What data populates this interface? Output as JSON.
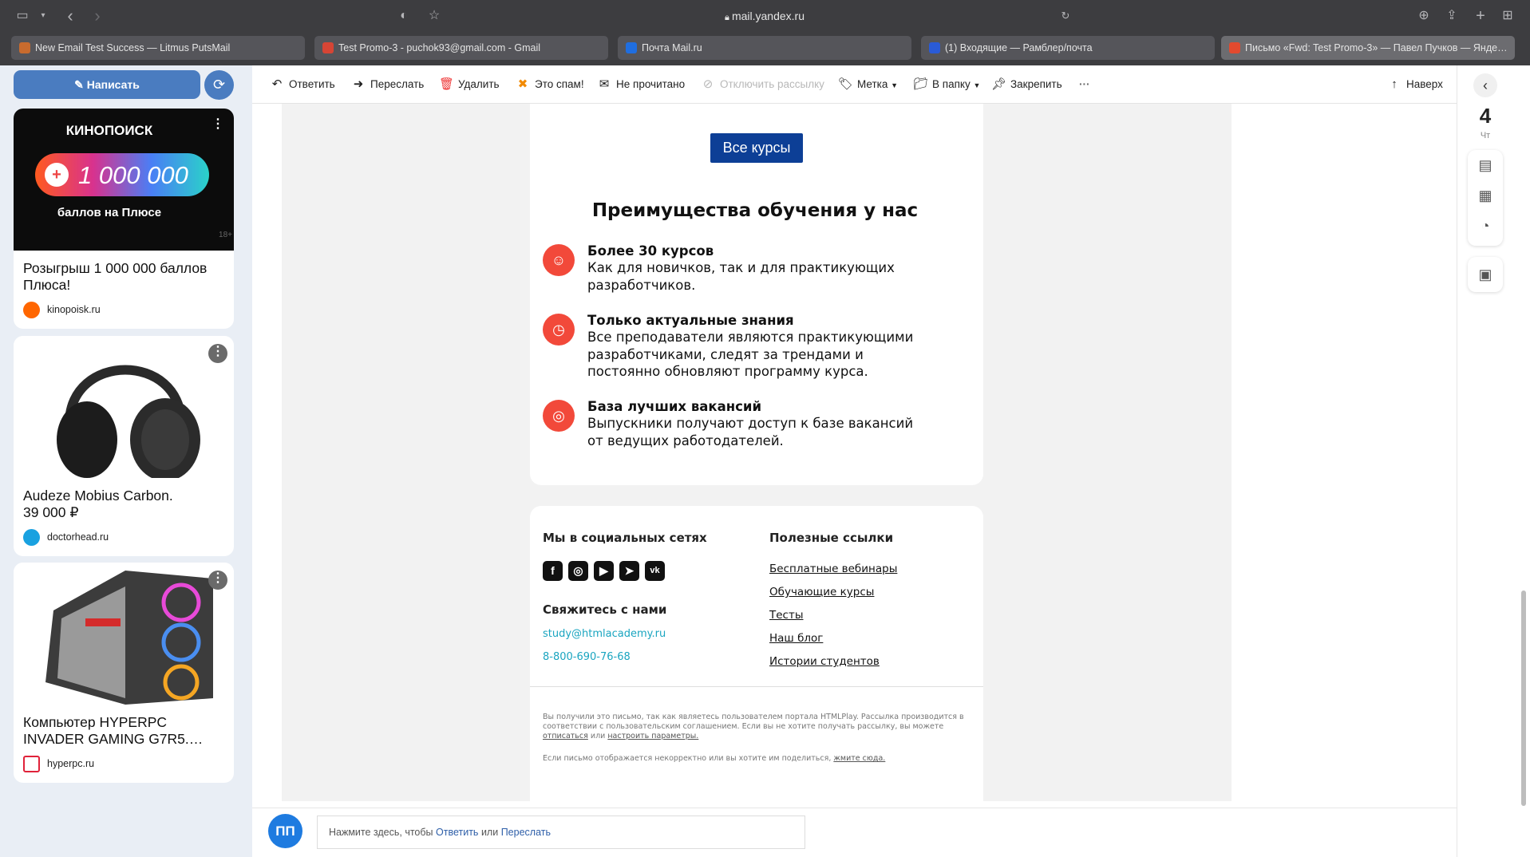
{
  "browser": {
    "url": "mail.yandex.ru",
    "tabs": [
      {
        "label": "New Email Test Success — Litmus PutsMail",
        "color": "#c86b2e"
      },
      {
        "label": "Test Promo-3 - puchok93@gmail.com - Gmail",
        "color": "#d64535"
      },
      {
        "label": "Почта Mail.ru",
        "color": "#1f6ee0"
      },
      {
        "label": "(1) Входящие — Рамблер/почта",
        "color": "#2a5bd7"
      },
      {
        "label": "Письмо «Fwd: Test Promo-3» — Павел Пучков — Янде…",
        "color": "#e24a2f"
      }
    ]
  },
  "sidebar": {
    "write_label": "Написать",
    "ads": [
      {
        "banner_brand": "КИНОПОИСК",
        "banner_value": "1 000 000",
        "banner_sub": "баллов на Плюсе",
        "banner_age": "18+",
        "title": "Розыгрыш 1 000 000 баллов Плюса!",
        "source": "kinopoisk.ru"
      },
      {
        "title": "Audeze Mobius Carbon. 39 000 ₽",
        "source": "doctorhead.ru"
      },
      {
        "title": "Компьютер HYPERPC INVADER GAMING G7R5.…",
        "source": "hyperpc.ru"
      }
    ]
  },
  "toolbar": {
    "reply": "Ответить",
    "forward": "Переслать",
    "delete": "Удалить",
    "spam": "Это спам!",
    "unread": "Не прочитано",
    "unsubscribe": "Отключить рассылку",
    "label": "Метка",
    "folder": "В папку",
    "pin": "Закрепить",
    "more": "···",
    "up": "Наверх"
  },
  "email": {
    "all_courses": "Все курсы",
    "benefits_title": "Преимущества обучения у нас",
    "features": [
      {
        "title": "Более 30 курсов",
        "text": "Как для новичков, так и для практикующих разработчиков."
      },
      {
        "title": "Только актуальные знания",
        "text": "Все преподаватели являются практикующими разработчиками, следят за трендами и постоянно обновляют программу курса."
      },
      {
        "title": "База лучших вакансий",
        "text": "Выпускники получают доступ к базе вакансий от ведущих работодателей."
      }
    ],
    "social_title": "Мы в социальных сетях",
    "contact_title": "Свяжитесь с нами",
    "email_addr": "study@htmlacademy.ru",
    "phone": "8-800-690-76-68",
    "links_title": "Полезные ссылки",
    "links": [
      "Бесплатные вебинары",
      "Обучающие курсы",
      "Тесты",
      "Наш блог",
      "Истории студентов"
    ],
    "fine1": "Вы получили это письмо, так как являетесь пользователем портала HTMLPlay. Рассылка производится в соответствии с пользовательским соглашением. Если вы не хотите получать рассылку, вы можете",
    "fine1_link1": "отписаться",
    "fine1_mid": "или",
    "fine1_link2": "настроить параметры.",
    "fine2": "Если письмо отображается некорректно или вы хотите им поделиться,",
    "fine2_link": "жмите сюда."
  },
  "right": {
    "day": "4",
    "weekday": "Чт"
  },
  "reply_bar": {
    "avatar": "ПП",
    "prefix": "Нажмите здесь, чтобы",
    "reply": "Ответить",
    "or": "или",
    "forward": "Переслать"
  }
}
